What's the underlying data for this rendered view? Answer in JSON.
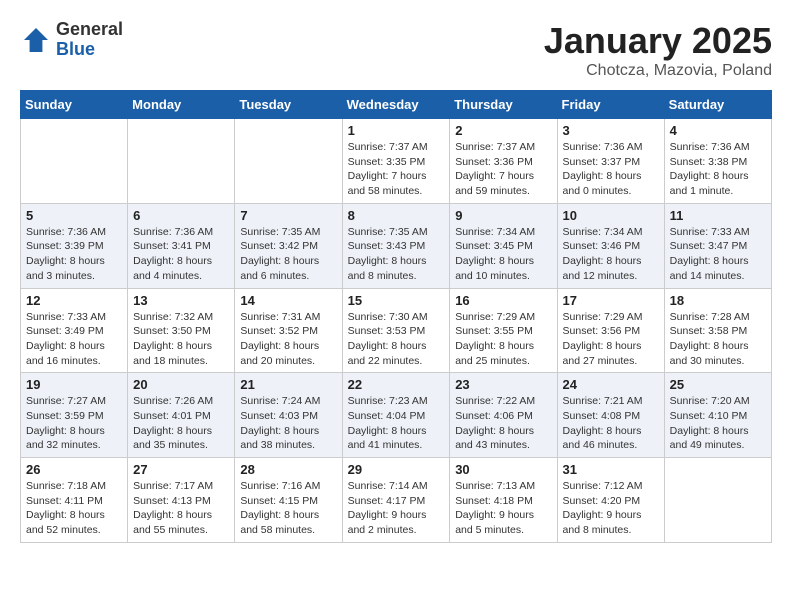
{
  "header": {
    "logo_general": "General",
    "logo_blue": "Blue",
    "month_title": "January 2025",
    "location": "Chotcza, Mazovia, Poland"
  },
  "days_of_week": [
    "Sunday",
    "Monday",
    "Tuesday",
    "Wednesday",
    "Thursday",
    "Friday",
    "Saturday"
  ],
  "weeks": [
    [
      {
        "day": "",
        "info": ""
      },
      {
        "day": "",
        "info": ""
      },
      {
        "day": "",
        "info": ""
      },
      {
        "day": "1",
        "info": "Sunrise: 7:37 AM\nSunset: 3:35 PM\nDaylight: 7 hours\nand 58 minutes."
      },
      {
        "day": "2",
        "info": "Sunrise: 7:37 AM\nSunset: 3:36 PM\nDaylight: 7 hours\nand 59 minutes."
      },
      {
        "day": "3",
        "info": "Sunrise: 7:36 AM\nSunset: 3:37 PM\nDaylight: 8 hours\nand 0 minutes."
      },
      {
        "day": "4",
        "info": "Sunrise: 7:36 AM\nSunset: 3:38 PM\nDaylight: 8 hours\nand 1 minute."
      }
    ],
    [
      {
        "day": "5",
        "info": "Sunrise: 7:36 AM\nSunset: 3:39 PM\nDaylight: 8 hours\nand 3 minutes."
      },
      {
        "day": "6",
        "info": "Sunrise: 7:36 AM\nSunset: 3:41 PM\nDaylight: 8 hours\nand 4 minutes."
      },
      {
        "day": "7",
        "info": "Sunrise: 7:35 AM\nSunset: 3:42 PM\nDaylight: 8 hours\nand 6 minutes."
      },
      {
        "day": "8",
        "info": "Sunrise: 7:35 AM\nSunset: 3:43 PM\nDaylight: 8 hours\nand 8 minutes."
      },
      {
        "day": "9",
        "info": "Sunrise: 7:34 AM\nSunset: 3:45 PM\nDaylight: 8 hours\nand 10 minutes."
      },
      {
        "day": "10",
        "info": "Sunrise: 7:34 AM\nSunset: 3:46 PM\nDaylight: 8 hours\nand 12 minutes."
      },
      {
        "day": "11",
        "info": "Sunrise: 7:33 AM\nSunset: 3:47 PM\nDaylight: 8 hours\nand 14 minutes."
      }
    ],
    [
      {
        "day": "12",
        "info": "Sunrise: 7:33 AM\nSunset: 3:49 PM\nDaylight: 8 hours\nand 16 minutes."
      },
      {
        "day": "13",
        "info": "Sunrise: 7:32 AM\nSunset: 3:50 PM\nDaylight: 8 hours\nand 18 minutes."
      },
      {
        "day": "14",
        "info": "Sunrise: 7:31 AM\nSunset: 3:52 PM\nDaylight: 8 hours\nand 20 minutes."
      },
      {
        "day": "15",
        "info": "Sunrise: 7:30 AM\nSunset: 3:53 PM\nDaylight: 8 hours\nand 22 minutes."
      },
      {
        "day": "16",
        "info": "Sunrise: 7:29 AM\nSunset: 3:55 PM\nDaylight: 8 hours\nand 25 minutes."
      },
      {
        "day": "17",
        "info": "Sunrise: 7:29 AM\nSunset: 3:56 PM\nDaylight: 8 hours\nand 27 minutes."
      },
      {
        "day": "18",
        "info": "Sunrise: 7:28 AM\nSunset: 3:58 PM\nDaylight: 8 hours\nand 30 minutes."
      }
    ],
    [
      {
        "day": "19",
        "info": "Sunrise: 7:27 AM\nSunset: 3:59 PM\nDaylight: 8 hours\nand 32 minutes."
      },
      {
        "day": "20",
        "info": "Sunrise: 7:26 AM\nSunset: 4:01 PM\nDaylight: 8 hours\nand 35 minutes."
      },
      {
        "day": "21",
        "info": "Sunrise: 7:24 AM\nSunset: 4:03 PM\nDaylight: 8 hours\nand 38 minutes."
      },
      {
        "day": "22",
        "info": "Sunrise: 7:23 AM\nSunset: 4:04 PM\nDaylight: 8 hours\nand 41 minutes."
      },
      {
        "day": "23",
        "info": "Sunrise: 7:22 AM\nSunset: 4:06 PM\nDaylight: 8 hours\nand 43 minutes."
      },
      {
        "day": "24",
        "info": "Sunrise: 7:21 AM\nSunset: 4:08 PM\nDaylight: 8 hours\nand 46 minutes."
      },
      {
        "day": "25",
        "info": "Sunrise: 7:20 AM\nSunset: 4:10 PM\nDaylight: 8 hours\nand 49 minutes."
      }
    ],
    [
      {
        "day": "26",
        "info": "Sunrise: 7:18 AM\nSunset: 4:11 PM\nDaylight: 8 hours\nand 52 minutes."
      },
      {
        "day": "27",
        "info": "Sunrise: 7:17 AM\nSunset: 4:13 PM\nDaylight: 8 hours\nand 55 minutes."
      },
      {
        "day": "28",
        "info": "Sunrise: 7:16 AM\nSunset: 4:15 PM\nDaylight: 8 hours\nand 58 minutes."
      },
      {
        "day": "29",
        "info": "Sunrise: 7:14 AM\nSunset: 4:17 PM\nDaylight: 9 hours\nand 2 minutes."
      },
      {
        "day": "30",
        "info": "Sunrise: 7:13 AM\nSunset: 4:18 PM\nDaylight: 9 hours\nand 5 minutes."
      },
      {
        "day": "31",
        "info": "Sunrise: 7:12 AM\nSunset: 4:20 PM\nDaylight: 9 hours\nand 8 minutes."
      },
      {
        "day": "",
        "info": ""
      }
    ]
  ]
}
